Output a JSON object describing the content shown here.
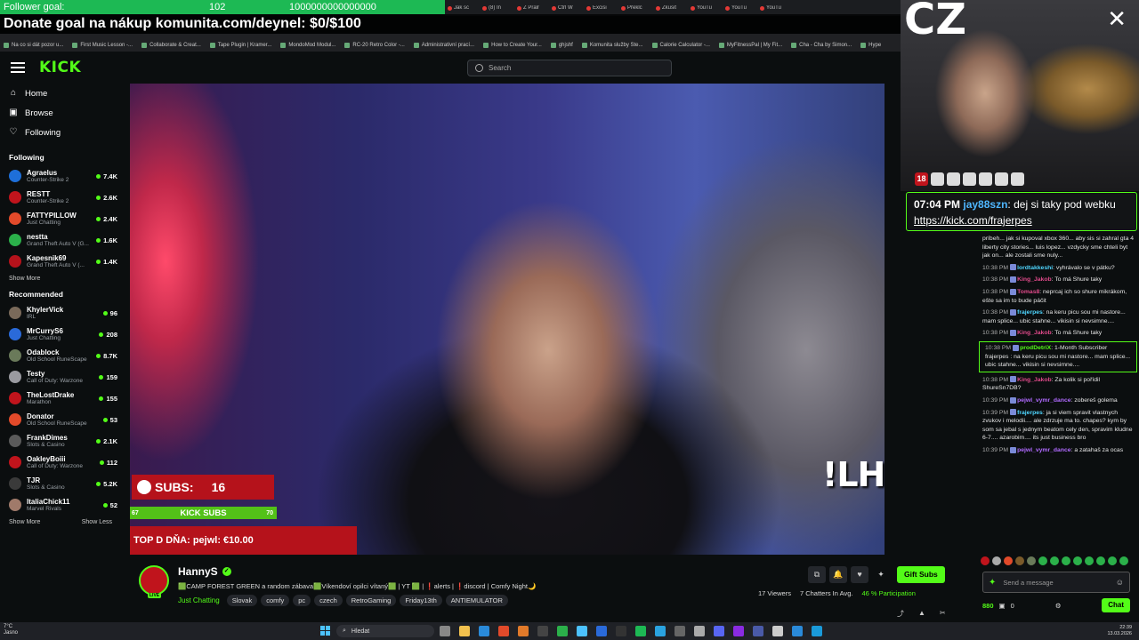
{
  "overlay": {
    "goal_label": "Follower goal:",
    "goal_current": "102",
    "goal_target": "1000000000000000",
    "donate": "Donate goal na nákup komunita.com/deynel: $0/$100"
  },
  "browser": {
    "tabs": [
      "Jak sc",
      "(8) In",
      "Z Pralr",
      "Ctrl W",
      "Excisi",
      "Překlc",
      "Zkusit",
      "YouTu",
      "YouTu",
      "YouTu"
    ],
    "bookmarks": [
      "Na co si dát pozor u...",
      "First Music Lesson -...",
      "Collaborate & Creat...",
      "Tape Plugin | Kramer...",
      "MondoMod Modul...",
      "RC-20 Retro Color -...",
      "Administrativní prací...",
      "How to Create Your...",
      "ghjshf",
      "Komunita služby Ste...",
      "Calorie Calculator -...",
      "MyFitnessPal | My Fit...",
      "Cha - Cha by Simon...",
      "Hype"
    ]
  },
  "header": {
    "logo": "KICK",
    "search_placeholder": "Search"
  },
  "sidebar": {
    "nav": [
      {
        "label": "Home",
        "icon": "home-icon"
      },
      {
        "label": "Browse",
        "icon": "browse-icon"
      },
      {
        "label": "Following",
        "icon": "heart-icon"
      }
    ],
    "following_title": "Following",
    "following": [
      {
        "name": "Agraelus",
        "category": "Counter-Strike 2",
        "viewers": "7.4K",
        "color": "#1e6fd9"
      },
      {
        "name": "RESTT",
        "category": "Counter-Strike 2",
        "viewers": "2.6K",
        "color": "#c0141c"
      },
      {
        "name": "FATTYPILLOW",
        "category": "Just Chatting",
        "viewers": "2.4K",
        "color": "#e24a2a"
      },
      {
        "name": "nestta",
        "category": "Grand Theft Auto V (G...",
        "viewers": "1.6K",
        "color": "#2bb04a"
      },
      {
        "name": "Kapesnik69",
        "category": "Grand Theft Auto V (...",
        "viewers": "1.4K",
        "color": "#b5121b"
      }
    ],
    "show_more_1": "Show More",
    "recommended_title": "Recommended",
    "recommended": [
      {
        "name": "KhylerVick",
        "category": "IRL",
        "viewers": "96",
        "color": "#7a6a5a"
      },
      {
        "name": "MrCurryS6",
        "category": "Just Chatting",
        "viewers": "208",
        "color": "#2a6ad9"
      },
      {
        "name": "Odablock",
        "category": "Old School RuneScape",
        "viewers": "8.7K",
        "color": "#6a7a5a"
      },
      {
        "name": "Testy",
        "category": "Call of Duty: Warzone",
        "viewers": "159",
        "color": "#9a9aa0"
      },
      {
        "name": "TheLostDrake",
        "category": "Marathon",
        "viewers": "155",
        "color": "#c0141c"
      },
      {
        "name": "Donator",
        "category": "Old School RuneScape",
        "viewers": "53",
        "color": "#e24a2a"
      },
      {
        "name": "FrankDimes",
        "category": "Slots & Casino",
        "viewers": "2.1K",
        "color": "#5a5a5a"
      },
      {
        "name": "OakleyBoiii",
        "category": "Call of Duty: Warzone",
        "viewers": "112",
        "color": "#c0141c"
      },
      {
        "name": "TJR",
        "category": "Slots & Casino",
        "viewers": "5.2K",
        "color": "#3a3a3a"
      },
      {
        "name": "ItaliaChick11",
        "category": "Marvel Rivals",
        "viewers": "52",
        "color": "#a07a6a"
      }
    ],
    "show_more_2": "Show More",
    "show_less": "Show Less"
  },
  "video_overlay": {
    "subs_label": "SUBS:",
    "subs_count": "16",
    "kick_subs": "KICK SUBS",
    "kick_subs_left": "67",
    "kick_subs_right": "70",
    "top_dna": "TOP D DŇA: pejwl: €10.00",
    "lhnoire": "!LHNoire"
  },
  "channel": {
    "name": "HannyS",
    "live": "LIVE",
    "title": "🟩CAMP FOREST GREEN a random zábava🟩Víkendoví opilci vítaný🟩 | YT 🟩 | ❗alerts | ❗discord | Comfy Night🌙",
    "category": "Just Chatting",
    "tags": [
      "Slovak",
      "comfy",
      "pc",
      "czech",
      "RetroGaming",
      "Friday13th",
      "ANTIEMULATOR"
    ],
    "gift_subs": "Gift Subs",
    "viewers": "17 Viewers",
    "chatters": "7 Chatters In Avg.",
    "participation": "46 % Participation"
  },
  "webcam": {
    "cz": "CZ",
    "badge_18": "18"
  },
  "highlight": {
    "time": "07:04 PM",
    "user": "jay88szn",
    "text": ": dej si taky pod webku ",
    "link": "https://kick.com/frajerpes"
  },
  "chat": {
    "messages": [
      {
        "time": "",
        "user": "",
        "color": "#e6e6e6",
        "text": "príbeh... jak si kupoval xbox 360... aby sis si zahral gta 4 liberty city stories... luis lopez... vzdycky sme chteli byt jak on... ale zostali sme nuly...",
        "boxed": false
      },
      {
        "time": "10:38 PM",
        "user": "lordtakkeshi",
        "color": "#4fd6ff",
        "text": ": vyhrávalo se v pátku?",
        "boxed": false
      },
      {
        "time": "10:38 PM",
        "user": "King_Jakob",
        "color": "#e04a8a",
        "text": ": To má Shure taky",
        "boxed": false
      },
      {
        "time": "10:38 PM",
        "user": "Tomas8",
        "color": "#e04a8a",
        "text": ": neprcaj ich so shure mikrákom, ešte sa im to bude páčit",
        "boxed": false
      },
      {
        "time": "10:38 PM",
        "user": "frajerpes",
        "color": "#4fd6ff",
        "text": ": na keru picu sou mi nastore... mam splice... ubic stahne... vikisin si nevsimne....",
        "boxed": false
      },
      {
        "time": "10:38 PM",
        "user": "King_Jakob",
        "color": "#e04a8a",
        "text": ": To má Shure taky",
        "boxed": false
      },
      {
        "time": "10:38 PM",
        "user": "prodDetriX",
        "color": "#53fc18",
        "text": ": 1-Month Subscriber frajerpes : na keru picu sou mi nastore... mam splice... ubic stahne... vikisin si nevsimne....",
        "boxed": true
      },
      {
        "time": "10:38 PM",
        "user": "King_Jakob",
        "color": "#e04a8a",
        "text": ": Za kolik si pořídil ShureSn7DB?",
        "boxed": false
      },
      {
        "time": "10:39 PM",
        "user": "pejwl_vymr_dance",
        "color": "#b06aff",
        "text": ": zobereš golema",
        "boxed": false
      },
      {
        "time": "10:39 PM",
        "user": "frajerpes",
        "color": "#4fd6ff",
        "text": ": ja si viem spravit vlastnych zvukov i melodii.... ale zdrzuje ma to. chapes? kym by som sa jebal s jednym beatom cely den, spravim kludne 6-7.... azarobim.... its just business bro",
        "boxed": false
      },
      {
        "time": "10:39 PM",
        "user": "pejwl_vymr_dance",
        "color": "#b06aff",
        "text": ": a zatahaš za ocas",
        "boxed": false
      }
    ],
    "input_placeholder": "Send a message",
    "points": "880",
    "gift_count": "0",
    "chat_button": "Chat"
  },
  "taskbar": {
    "weather": "7°C",
    "weather_sub": "Jasno",
    "search": "Hledat",
    "time": "22:39",
    "date": "13.03.2026"
  }
}
